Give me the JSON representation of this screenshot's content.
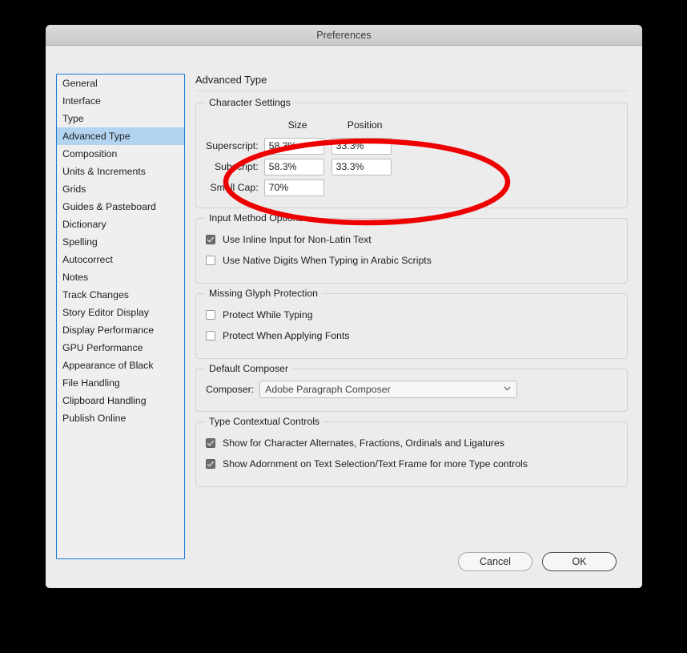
{
  "window": {
    "title": "Preferences"
  },
  "sidebar": {
    "items": [
      {
        "label": "General",
        "selected": false
      },
      {
        "label": "Interface",
        "selected": false
      },
      {
        "label": "Type",
        "selected": false
      },
      {
        "label": "Advanced Type",
        "selected": true
      },
      {
        "label": "Composition",
        "selected": false
      },
      {
        "label": "Units & Increments",
        "selected": false
      },
      {
        "label": "Grids",
        "selected": false
      },
      {
        "label": "Guides & Pasteboard",
        "selected": false
      },
      {
        "label": "Dictionary",
        "selected": false
      },
      {
        "label": "Spelling",
        "selected": false
      },
      {
        "label": "Autocorrect",
        "selected": false
      },
      {
        "label": "Notes",
        "selected": false
      },
      {
        "label": "Track Changes",
        "selected": false
      },
      {
        "label": "Story Editor Display",
        "selected": false
      },
      {
        "label": "Display Performance",
        "selected": false
      },
      {
        "label": "GPU Performance",
        "selected": false
      },
      {
        "label": "Appearance of Black",
        "selected": false
      },
      {
        "label": "File Handling",
        "selected": false
      },
      {
        "label": "Clipboard Handling",
        "selected": false
      },
      {
        "label": "Publish Online",
        "selected": false
      }
    ]
  },
  "pane": {
    "title": "Advanced Type",
    "character_settings": {
      "legend": "Character Settings",
      "col_size": "Size",
      "col_position": "Position",
      "rows": [
        {
          "label": "Superscript:",
          "size": "58.3%",
          "position": "33.3%"
        },
        {
          "label": "Subscript:",
          "size": "58.3%",
          "position": "33.3%"
        },
        {
          "label": "Small Cap:",
          "size": "70%",
          "position": null
        }
      ]
    },
    "input_method_options": {
      "legend": "Input Method Options",
      "checkboxes": [
        {
          "label": "Use Inline Input for Non-Latin Text",
          "checked": true
        },
        {
          "label": "Use Native Digits When Typing in Arabic Scripts",
          "checked": false
        }
      ]
    },
    "missing_glyph_protection": {
      "legend": "Missing Glyph Protection",
      "checkboxes": [
        {
          "label": "Protect While Typing",
          "checked": false
        },
        {
          "label": "Protect When Applying Fonts",
          "checked": false
        }
      ]
    },
    "default_composer": {
      "legend": "Default Composer",
      "field_label": "Composer:",
      "value": "Adobe Paragraph Composer",
      "chevron_icon": "chevron-down-icon"
    },
    "type_contextual_controls": {
      "legend": "Type Contextual Controls",
      "checkboxes": [
        {
          "label": "Show for Character Alternates, Fractions, Ordinals and Ligatures",
          "checked": true
        },
        {
          "label": "Show Adornment on Text Selection/Text Frame for more Type controls",
          "checked": true
        }
      ]
    }
  },
  "footer": {
    "cancel_label": "Cancel",
    "ok_label": "OK"
  },
  "annotation": {
    "type": "ellipse-highlight",
    "color": "#ee0000",
    "targets": "Character Settings superscript, subscript and small cap fields"
  }
}
